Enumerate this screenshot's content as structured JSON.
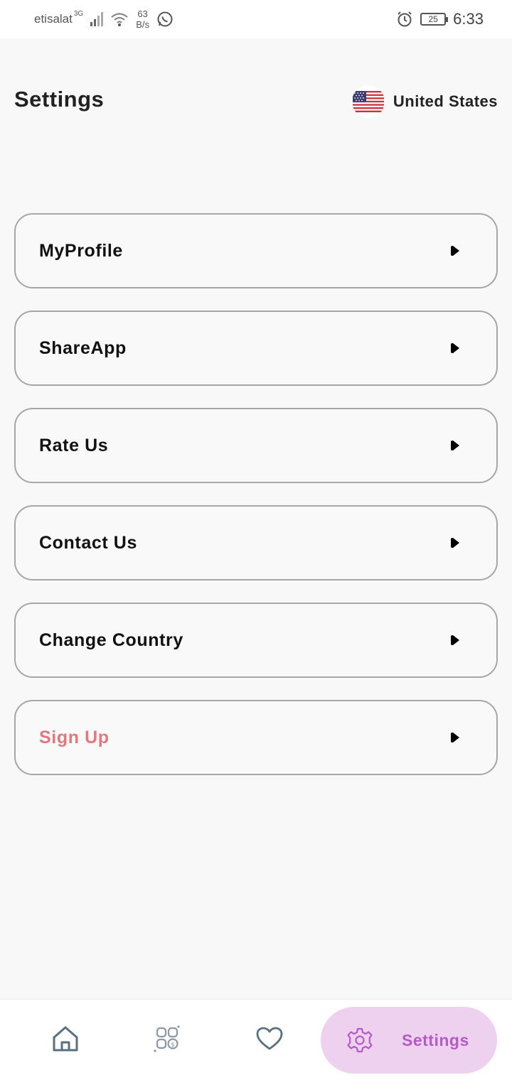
{
  "status_bar": {
    "carrier": "etisalat",
    "network_type": "3G",
    "speed_value": "63",
    "speed_unit": "B/s",
    "battery": "25",
    "time": "6:33",
    "icons": [
      "signal-icon",
      "wifi-icon",
      "whatsapp-icon",
      "alarm-icon",
      "battery-icon"
    ]
  },
  "header": {
    "title": "Settings",
    "country": "United States",
    "flag_icon": "us-flag-icon"
  },
  "menu": {
    "items": [
      {
        "label": "MyProfile"
      },
      {
        "label": "ShareApp"
      },
      {
        "label": "Rate Us"
      },
      {
        "label": "Contact Us"
      },
      {
        "label": "Change Country"
      },
      {
        "label": "Sign Up",
        "color": "#e07a7f"
      }
    ]
  },
  "bottom_nav": {
    "items": [
      {
        "icon": "home-icon"
      },
      {
        "icon": "deals-grid-icon"
      },
      {
        "icon": "heart-icon"
      },
      {
        "icon": "gear-icon",
        "label": "Settings",
        "active": true
      }
    ],
    "active_color": "#b25cc4",
    "active_bg": "#edd1ee"
  }
}
